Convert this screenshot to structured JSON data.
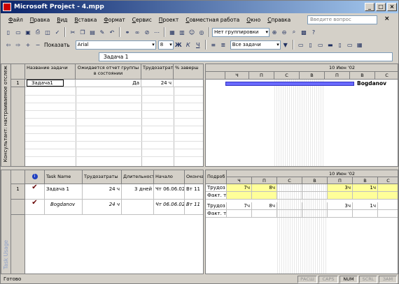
{
  "window": {
    "title": "Microsoft Project - 4.mpp"
  },
  "title_buttons": [
    "_",
    "□",
    "×"
  ],
  "menu": [
    "Файл",
    "Правка",
    "Вид",
    "Вставка",
    "Формат",
    "Сервис",
    "Проект",
    "Совместная работа",
    "Окно",
    "Справка"
  ],
  "help_search": {
    "placeholder": "Введите вопрос"
  },
  "toolbar1": {
    "group_combo": "Нет группировки"
  },
  "toolbar2": {
    "show_label": "Показать",
    "font": "Arial",
    "size": "8",
    "filter": "Все задачи"
  },
  "entry_bar": {
    "value": "Задача 1"
  },
  "top_view": {
    "side_label": "Консультант: настраиваемое отслеж",
    "columns": [
      "Название задачи",
      "Ожидается отчет группы в состоянии",
      "Трудозатраты",
      "% заверш"
    ],
    "rows": [
      {
        "num": "1",
        "name": "Задача1",
        "status": "Да",
        "work": "24 ч"
      }
    ],
    "timescale": {
      "top": "10 Июн '02",
      "days": [
        "Ч",
        "П",
        "С",
        "В",
        "П",
        "В",
        "С"
      ]
    },
    "bar_label": "Bogdanov"
  },
  "bottom_view": {
    "side_label": "Task Usage",
    "columns": [
      "Task Name",
      "Трудозатраты",
      "Длительность",
      "Начало",
      "Окончание"
    ],
    "rows": [
      {
        "num": "1",
        "name": "Задача 1",
        "work": "24 ч",
        "duration": "3 дней",
        "start": "Чт 06.06.02",
        "finish": "Вт 11"
      },
      {
        "num": "",
        "name": "Bogdanov",
        "work": "24 ч",
        "duration": "",
        "start": "Чт 06.06.02",
        "finish": "Вт 11"
      }
    ],
    "timescale": {
      "label": "Подроб",
      "top": "10 Июн '02",
      "days": [
        "Ч",
        "П",
        "С",
        "В",
        "П",
        "В",
        "С"
      ]
    },
    "detail_rows": [
      {
        "label": "Трудоз",
        "values": [
          "7ч",
          "8ч",
          "",
          "",
          "3ч",
          "1ч",
          ""
        ]
      },
      {
        "label": "Факт. т",
        "values": [
          "",
          "",
          "",
          "",
          "",
          "",
          ""
        ]
      },
      {
        "label": "Трудоз",
        "values": [
          "7ч",
          "8ч",
          "",
          "",
          "3ч",
          "1ч",
          ""
        ]
      },
      {
        "label": "Факт. т",
        "values": [
          "",
          "",
          "",
          "",
          "",
          "",
          ""
        ]
      }
    ]
  },
  "status": {
    "ready": "Готово",
    "indicators": [
      "РАСШ",
      "CAPS",
      "NUM",
      "SCRL",
      "ЗАМ"
    ]
  },
  "colors": {
    "title_start": "#0a246a",
    "gantt_bar": "#6a6aff",
    "usage_highlight": "#ffff99"
  }
}
